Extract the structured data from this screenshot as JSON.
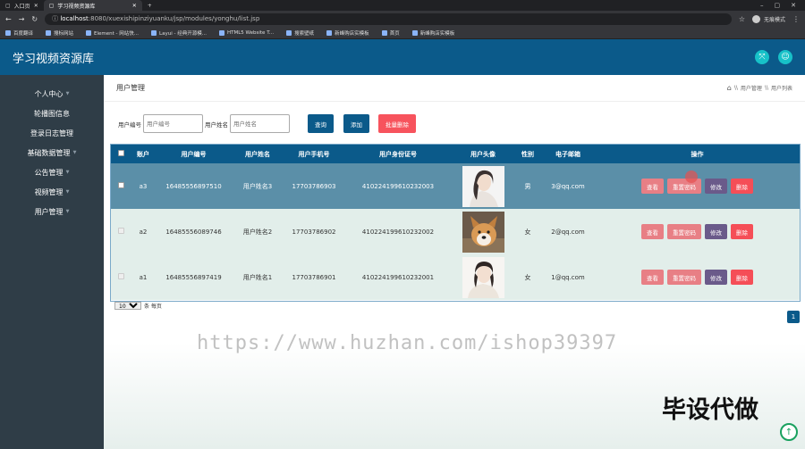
{
  "browser": {
    "tabs": [
      {
        "label": "入口页"
      },
      {
        "label": "学习视频资源库"
      }
    ],
    "url_host": "localhost",
    "url_path": ":8080/xuexishipinziyuanku/jsp/modules/yonghu/list.jsp",
    "profile": "无痕模式",
    "bookmarks": [
      "百度翻译",
      "搜标网站",
      "Element - 网站快...",
      "Layui - 经典开源模...",
      "HTML5 Website T...",
      "搜索壁纸",
      "新峰购店实模板",
      "首页",
      "新峰购店实模板"
    ]
  },
  "app": {
    "title": "学习视频资源库",
    "header_icons": [
      "fullscreen-icon",
      "user-icon"
    ]
  },
  "sidebar": {
    "items": [
      {
        "label": "个人中心",
        "has_caret": true
      },
      {
        "label": "轮播图信息",
        "has_caret": false
      },
      {
        "label": "登录日志管理",
        "has_caret": false
      },
      {
        "label": "基础数据管理",
        "has_caret": true
      },
      {
        "label": "公告管理",
        "has_caret": true
      },
      {
        "label": "视频管理",
        "has_caret": true
      },
      {
        "label": "用户管理",
        "has_caret": true
      }
    ]
  },
  "main": {
    "page_title": "用户管理",
    "breadcrumb": [
      "用户管理",
      "用户列表"
    ],
    "breadcrumb_sep": "\\\\",
    "search": {
      "code_label": "用户编号",
      "code_placeholder": "用户编号",
      "name_label": "用户姓名",
      "name_placeholder": "用户姓名",
      "query_label": "查询",
      "add_label": "添加",
      "batch_delete_label": "批量删除"
    },
    "table": {
      "columns": [
        "账户",
        "用户编号",
        "用户姓名",
        "用户手机号",
        "用户身份证号",
        "用户头像",
        "性别",
        "电子邮箱",
        "操作"
      ],
      "rows": [
        {
          "account": "a3",
          "code": "16485556897510",
          "name": "用户姓名3",
          "phone": "17703786903",
          "id_card": "410224199610232003",
          "avatar": "woman-portrait",
          "gender": "男",
          "email": "3@qq.com"
        },
        {
          "account": "a2",
          "code": "16485556089746",
          "name": "用户姓名2",
          "phone": "17703786902",
          "id_card": "410224199610232002",
          "avatar": "dog-photo",
          "gender": "女",
          "email": "2@qq.com"
        },
        {
          "account": "a1",
          "code": "16485556897419",
          "name": "用户姓名1",
          "phone": "17703786901",
          "id_card": "410224199610232001",
          "avatar": "woman-portrait",
          "gender": "女",
          "email": "1@qq.com"
        }
      ],
      "actions": {
        "view": "查看",
        "reset_password": "重置密码",
        "edit": "修改",
        "delete": "删除"
      }
    },
    "pager": {
      "page_size": "10",
      "per_page_label": "条 每页",
      "current_page": "1"
    }
  },
  "overlay": {
    "watermark_url": "https://www.huzhan.com/ishop39397",
    "watermark_cn": "毕设代做"
  },
  "colors": {
    "primary": "#0b5a8a",
    "sidebar": "#2f3d47",
    "danger": "#f54e57",
    "pink": "#e87f85",
    "purple": "#6a5a8a",
    "teal": "#17c1c8"
  }
}
